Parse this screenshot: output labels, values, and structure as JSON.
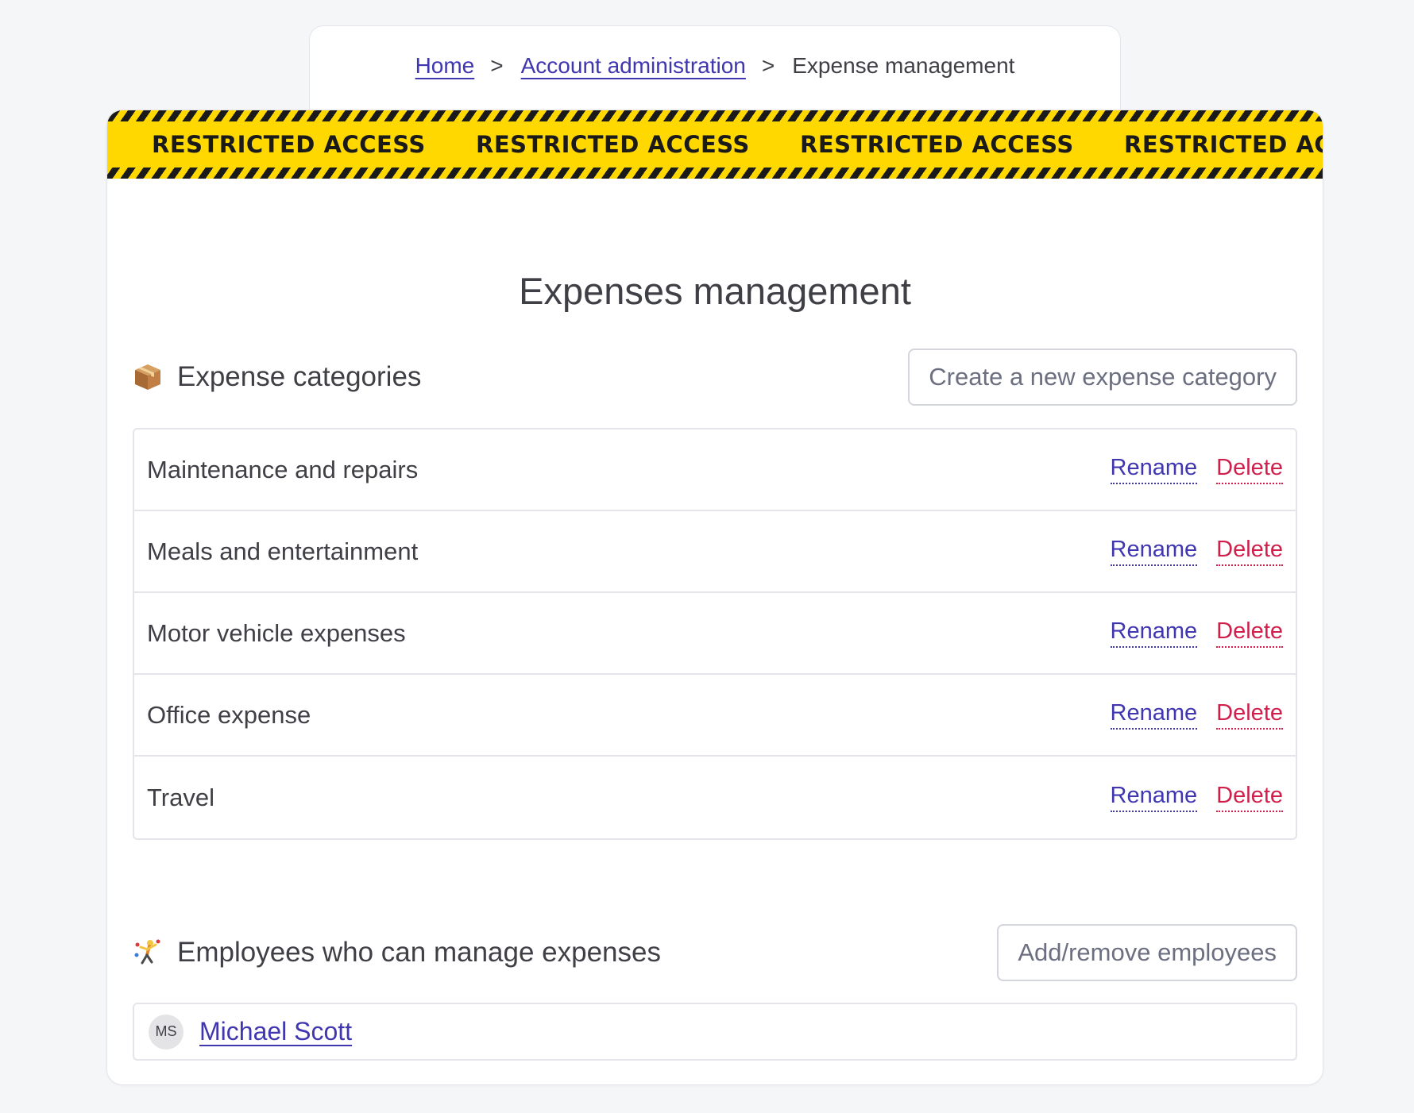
{
  "breadcrumb": {
    "items": [
      {
        "label": "Home"
      },
      {
        "label": "Account administration"
      }
    ],
    "separator": ">",
    "current": "Expense management"
  },
  "banner": {
    "text": "RESTRICTED ACCESS",
    "colors": {
      "tape": "#ffd800",
      "stripe": "#1a1a1a"
    }
  },
  "page": {
    "title": "Expenses management"
  },
  "categories": {
    "title": "Expense categories",
    "icon": "package-icon",
    "create_button": "Create a new expense category",
    "items": [
      {
        "name": "Maintenance and repairs",
        "rename": "Rename",
        "delete": "Delete"
      },
      {
        "name": "Meals and entertainment",
        "rename": "Rename",
        "delete": "Delete"
      },
      {
        "name": "Motor vehicle expenses",
        "rename": "Rename",
        "delete": "Delete"
      },
      {
        "name": "Office expense",
        "rename": "Rename",
        "delete": "Delete"
      },
      {
        "name": "Travel",
        "rename": "Rename",
        "delete": "Delete"
      }
    ]
  },
  "employees": {
    "title": "Employees who can manage expenses",
    "icon": "juggler-icon",
    "manage_button": "Add/remove employees",
    "items": [
      {
        "initials": "MS",
        "name": "Michael Scott"
      }
    ]
  },
  "colors": {
    "link": "#3f36b0",
    "danger": "#cf1f4a",
    "background": "#f5f6f8"
  }
}
